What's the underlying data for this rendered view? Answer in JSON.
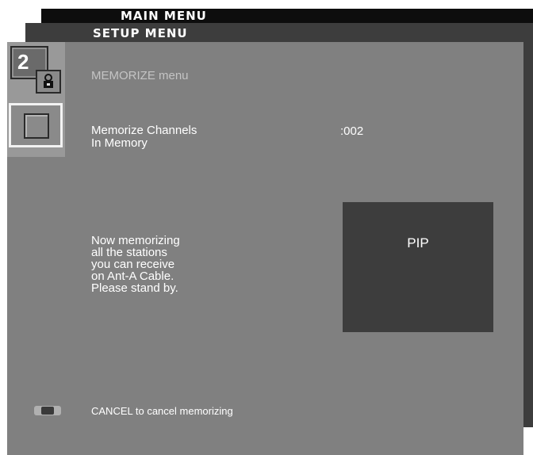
{
  "main_menu": {
    "title": "MAIN MENU"
  },
  "setup_menu": {
    "title": "SETUP MENU"
  },
  "memorize": {
    "menu_title": "MEMORIZE menu",
    "icon_number": "2",
    "row_label_line1": "Memorize Channels",
    "row_label_line2": "In Memory",
    "row_value": ":002",
    "message": "Now memorizing\nall the stations\nyou can receive\non Ant-A Cable.\nPlease stand by.",
    "pip_label": "PIP",
    "cancel_hint": "CANCEL to cancel memorizing"
  },
  "icons": {
    "memorize": "memorize-tv-lock-icon",
    "selection": "selection-square-icon",
    "cancel": "remote-cancel-button-icon"
  },
  "colors": {
    "panel": "#808080",
    "setup_layer": "#3d3d3d",
    "main_layer": "#0d0d0d",
    "pip_window": "#3d3d3d",
    "text": "#ffffff"
  }
}
